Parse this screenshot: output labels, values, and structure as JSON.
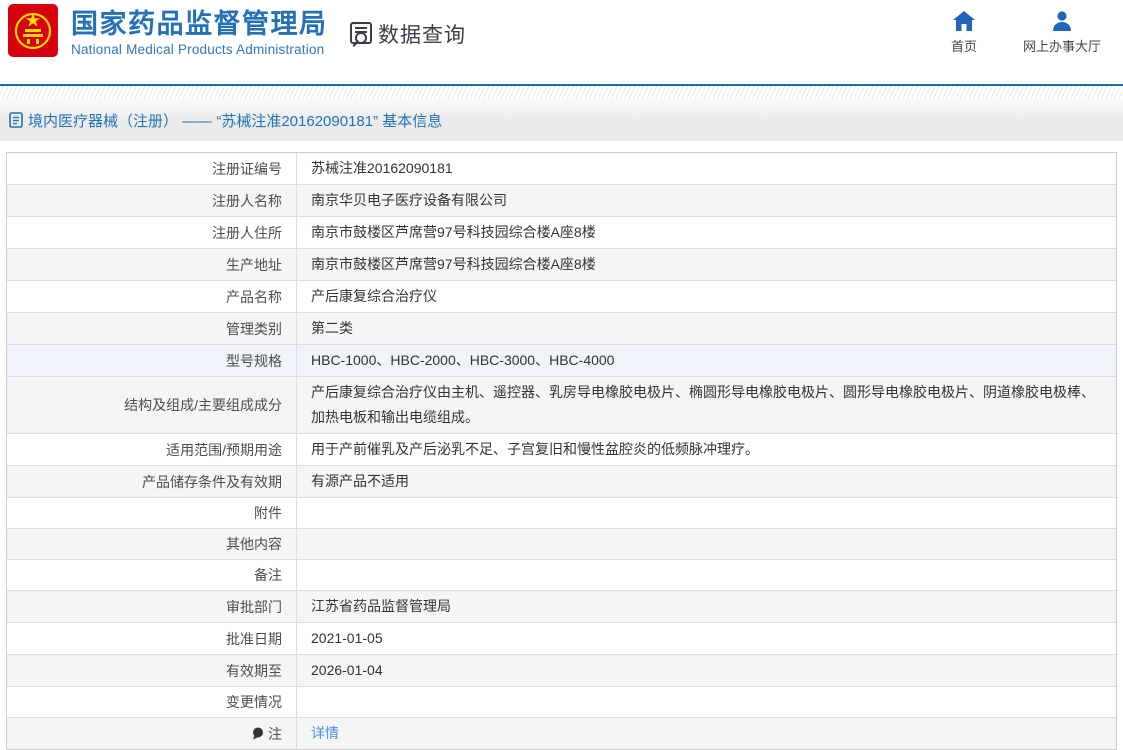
{
  "header": {
    "org_name_cn": "国家药品监督管理局",
    "org_name_en": "National Medical Products Administration",
    "section_title": "数据查询",
    "nav": [
      {
        "label": "首页",
        "icon": "home-icon"
      },
      {
        "label": "网上办事大厅",
        "icon": "user-icon"
      }
    ]
  },
  "breadcrumb": {
    "text": "境内医疗器械（注册） —— “苏械注准20162090181” 基本信息"
  },
  "table": {
    "rows": [
      {
        "label": "注册证编号",
        "value": "苏械注准20162090181"
      },
      {
        "label": "注册人名称",
        "value": "南京华贝电子医疗设备有限公司"
      },
      {
        "label": "注册人住所",
        "value": "南京市鼓楼区芦席营97号科技园综合楼A座8楼"
      },
      {
        "label": "生产地址",
        "value": "南京市鼓楼区芦席营97号科技园综合楼A座8楼"
      },
      {
        "label": "产品名称",
        "value": "产后康复综合治疗仪"
      },
      {
        "label": "管理类别",
        "value": "第二类"
      },
      {
        "label": "型号规格",
        "value": "HBC-1000、HBC-2000、HBC-3000、HBC-4000"
      },
      {
        "label": "结构及组成/主要组成成分",
        "value": "产后康复综合治疗仪由主机、遥控器、乳房导电橡胶电极片、椭圆形导电橡胶电极片、圆形导电橡胶电极片、阴道橡胶电极棒、加热电板和输出电缆组成。"
      },
      {
        "label": "适用范围/预期用途",
        "value": "用于产前催乳及产后泌乳不足、子宫复旧和慢性盆腔炎的低频脉冲理疗。"
      },
      {
        "label": "产品储存条件及有效期",
        "value": "有源产品不适用"
      },
      {
        "label": "附件",
        "value": ""
      },
      {
        "label": "其他内容",
        "value": ""
      },
      {
        "label": "备注",
        "value": ""
      },
      {
        "label": "审批部门",
        "value": "江苏省药品监督管理局"
      },
      {
        "label": "批准日期",
        "value": "2021-01-05"
      },
      {
        "label": "有效期至",
        "value": "2026-01-04"
      },
      {
        "label": "变更情况",
        "value": ""
      },
      {
        "label": "注",
        "value": "详情"
      }
    ]
  },
  "colors": {
    "brand_blue": "#2471b8",
    "line_blue": "#1a68b5",
    "link_blue": "#4a90e2",
    "emblem_red": "#d7000f",
    "emblem_gold": "#ffd700",
    "row_alt": "#f5f5f5",
    "row_hover": "#f0f3f9"
  }
}
